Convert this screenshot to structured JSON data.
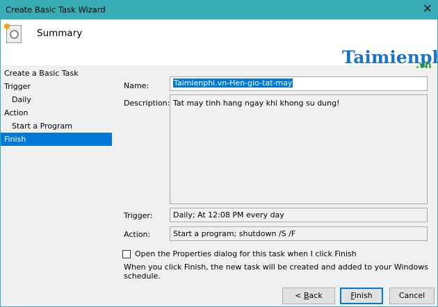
{
  "window": {
    "title": "Create Basic Task Wizard",
    "close": "✕"
  },
  "header": {
    "title": "Summary"
  },
  "watermark": {
    "brand": "Taimienphi",
    "tld": ".vn"
  },
  "sidebar": {
    "items": [
      {
        "label": "Create a Basic Task"
      },
      {
        "label": "Trigger"
      },
      {
        "label": "Daily"
      },
      {
        "label": "Action"
      },
      {
        "label": "Start a Program"
      },
      {
        "label": "Finish"
      }
    ]
  },
  "form": {
    "name_label": "Name:",
    "name_value": "Taimienphi.vn-Hen-gio-tat-may",
    "description_label": "Description:",
    "description_value": "Tat may tinh hang ngay khi khong su dung!",
    "trigger_label": "Trigger:",
    "trigger_value": "Daily; At 12:08 PM every day",
    "action_label": "Action:",
    "action_value": "Start a program; shutdown /S /F"
  },
  "checkbox": {
    "label": "Open the Properties dialog for this task when I click Finish",
    "checked": false
  },
  "info": "When you click Finish, the new task will be created and added to your Windows schedule.",
  "buttons": {
    "back_prefix": "< ",
    "back_key": "B",
    "back_rest": "ack",
    "finish_key": "F",
    "finish_rest": "inish",
    "cancel": "Cancel"
  }
}
